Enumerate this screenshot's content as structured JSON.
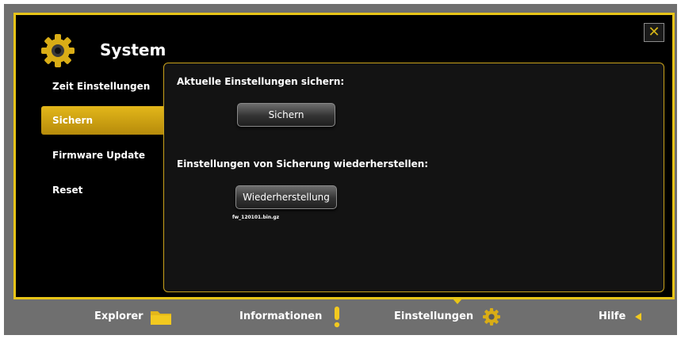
{
  "header": {
    "title": "System",
    "close_label": "✕"
  },
  "sidebar": {
    "items": [
      {
        "label": "Zeit Einstellungen"
      },
      {
        "label": "Sichern"
      },
      {
        "label": "Firmware Update"
      },
      {
        "label": "Reset"
      }
    ],
    "active_index": 1
  },
  "main": {
    "backup_heading": "Aktuelle Einstellungen sichern:",
    "backup_button": "Sichern",
    "restore_heading": "Einstellungen von Sicherung wiederherstellen:",
    "restore_button": "Wiederherstellung",
    "restore_file": "fw_120101.bin.gz"
  },
  "bottom_nav": {
    "items": [
      {
        "label": "Explorer",
        "icon": "folder-icon"
      },
      {
        "label": "Informationen",
        "icon": "exclamation-icon"
      },
      {
        "label": "Einstellungen",
        "icon": "gear-icon"
      },
      {
        "label": "Hilfe",
        "icon": "triangle-left-icon"
      }
    ],
    "active_index": 2
  },
  "colors": {
    "accent": "#e8c417",
    "background": "#000000",
    "frame": "#6f6f6f"
  }
}
